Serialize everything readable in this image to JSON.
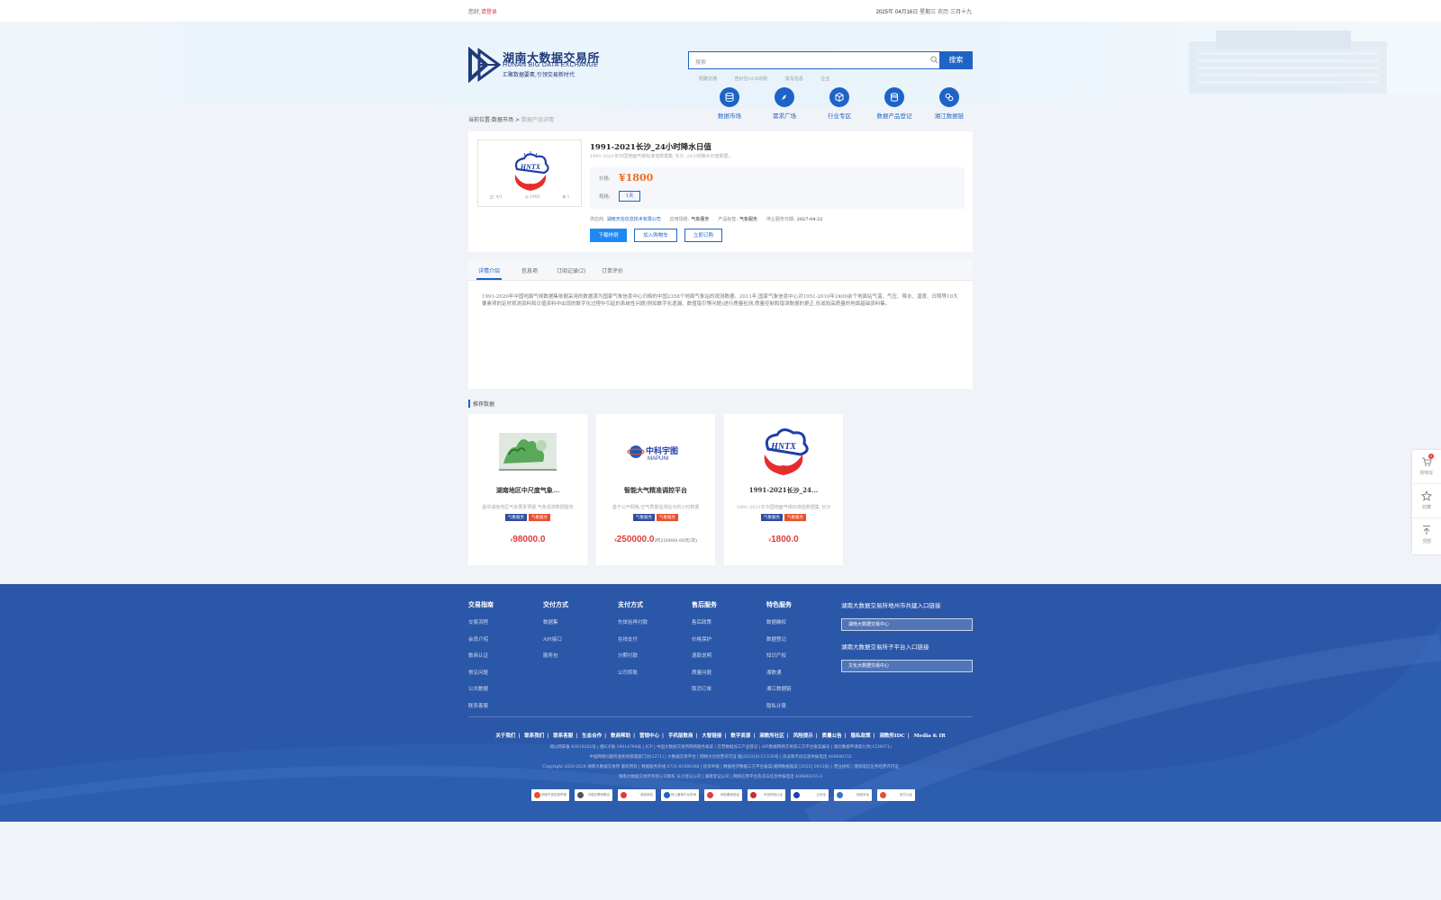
{
  "topbar": {
    "greeting": "您好,",
    "login": "请登录",
    "date_prefix": "2025",
    "date_y": "年",
    "date_m": "04",
    "date_m_label": "月",
    "date_d": "16",
    "date_rest": "日 星期三 农历 三月十九"
  },
  "header": {
    "logo_cn": "湖南大数据交易所",
    "logo_en": "HUNAN BIG DATA EXCHANGE",
    "logo_slogan": "汇聚数据要素,引领交易新时代",
    "search_placeholder": "搜索",
    "search_button": "搜索",
    "hot_links": [
      "短路交通",
      "告价位OCR识别",
      "批写信息",
      "企业"
    ],
    "nav": [
      {
        "label": "数据市场",
        "icon": "database-icon"
      },
      {
        "label": "需求广场",
        "icon": "compass-icon"
      },
      {
        "label": "行业专区",
        "icon": "cube-icon"
      },
      {
        "label": "数据产品登记",
        "icon": "register-icon"
      },
      {
        "label": "湘江数据链",
        "icon": "chain-icon"
      }
    ]
  },
  "breadcrumb": {
    "label": "当前位置:",
    "parent": "数据市场",
    "separator": ">",
    "current": "数据产品详情"
  },
  "product": {
    "title": "1991-2021长沙_24小时降水日值",
    "subtitle": "1991-2021年中国地面气候标准值数据集_长沙_24小时降水日值数据。",
    "price_label": "价格:",
    "price": "¥1800",
    "spec_label": "规格:",
    "spec_value": "1天",
    "stats": [
      "4/1",
      "1993",
      "1"
    ],
    "meta": {
      "provider_label": "供应商:",
      "provider": "湖南天信信息技术有限公司",
      "scene_label": "应用场景:",
      "scene": "气象服务",
      "tag_label": "产品标签:",
      "tag": "气象服务",
      "date_label": "停止服务日期:",
      "date": "2027-04-22"
    },
    "buttons": [
      "下载样例",
      "加入购物车",
      "立即订购"
    ]
  },
  "tabs": {
    "items": [
      "详情介绍",
      "信息项",
      "订阅记录(2)",
      "订单评价"
    ],
    "content": "1991-2020年中国地面气候数据集依据采用的数据源为国家气象信息中心归档的中国2358个地面气象站的观测数据。2011年,国家气象信息中心对1951-2010年2400余个地面站气温、气压、降水、湿度、日照等10大要素项的定时观测资料和日值资料中出现的数字化过程中引起的系统性问题(例如数字化遗漏、数值错引等问题)进行质量检测,质量控制和错误数据的更正,形成较高质量的地面基础资料集。"
  },
  "recommend": {
    "title": "推荐数据",
    "cards": [
      {
        "name": "湖南地区中尺度气象...",
        "desc": "提供湖南地区气象要素预报,气象观测数据服务",
        "tags": [
          "气象服务",
          "气象服务"
        ],
        "currency": "¥",
        "price": "98000.0",
        "unit": ""
      },
      {
        "name": "智能大气精准调控平台",
        "desc": "基于公开网格,空气质量监测站点的小时数据",
        "tags": [
          "气象服务",
          "气象服务"
        ],
        "currency": "¥",
        "price": "250000.0",
        "unit": "(约250000.00元/次)"
      },
      {
        "name": "1991-2021长沙_24...",
        "desc": "1991-2021年中国地面气候标准值数据集_长沙",
        "tags": [
          "气象服务",
          "气象服务"
        ],
        "currency": "¥",
        "price": "1800.0",
        "unit": ""
      }
    ]
  },
  "float": {
    "items": [
      {
        "label": "购物车",
        "icon": "cart-icon",
        "count": "0"
      },
      {
        "label": "收藏",
        "icon": "star-icon"
      },
      {
        "label": "顶部",
        "icon": "back-to-top-icon"
      }
    ]
  },
  "footer": {
    "columns": [
      {
        "title": "交易指南",
        "items": [
          "交易流程",
          "会员介绍",
          "数商认证",
          "常见问题",
          "公共数据",
          "联系客服"
        ]
      },
      {
        "title": "交付方式",
        "items": [
          "数据集",
          "API接口",
          "服务包"
        ]
      },
      {
        "title": "支付方式",
        "items": [
          "先体验再付款",
          "在线支付",
          "分期付款",
          "公司转账"
        ]
      },
      {
        "title": "售后服务",
        "items": [
          "售后政策",
          "价格保护",
          "退款说明",
          "质量问题",
          "取消订单"
        ]
      },
      {
        "title": "特色服务",
        "items": [
          "数据确权",
          "数据登记",
          "知识产权",
          "湘数通",
          "湘江数据链",
          "隐私计算"
        ]
      }
    ],
    "right": {
      "t1": "湖南大数据交易所地州市共建入口链接",
      "s1": "湖南大数据交易中心",
      "t2": "湖南大数据交易所子平台入口链接",
      "s2": "文化大数据交易中心"
    },
    "links": [
      "关于我们",
      "联系我们",
      "联系客服",
      "生态合作",
      "数商帮助",
      "营销中心",
      "手机版数商",
      "大智链接",
      "数字资源",
      "湘数所社区",
      "风险提示",
      "质量公告",
      "隐私政策",
      "湘数所IDC",
      "Media & IR"
    ],
    "lines": [
      "湘公网安备 43010202号  |  湘ICP备 19014784号  |  ICP  |  中国大数据交易所网络服务备案  |  在营数据加工产品登记  |  API数据网络交易第三方平台备案编号  |  湖北数据申请第九项(1230071)",
      "中国网络问题检查机构管理部门对(1271)  |  大数据交易平台  |  网络文化经营许可证 湘(2023)0112-120号  |  违法和不良信息举报电话 400686155",
      "Copyright 2020-2024 湖南大数据交易所 版权所有  |  数据服务热线 0731-81880388  |  投诉举报  |  数据经济数据三方平台备案(湘网数据备案 [2023] 0013号)  |  营业执照  |  增值电信业务经营许可证",
      "湖南大数据交易所有限公司版权  长沙登记公司  |  湖南登记公司  |  网络信用平台及违法信息举报电话 400686155-3"
    ],
    "badges": [
      "网络不良信息举报",
      "中国互联网联合",
      "诚信网站",
      "网上备案平台查询",
      "网站备案验证",
      "可信网站认证",
      "云安全",
      "网站安全",
      "官方认证"
    ]
  }
}
